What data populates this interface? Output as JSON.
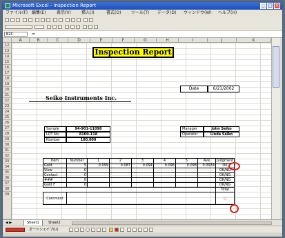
{
  "window": {
    "title": "Microsoft Excel - Inspection Report"
  },
  "menu": [
    "ファイル(F)",
    "編集(E)",
    "表示(V)",
    "挿入(I)",
    "書式(O)",
    "ツール(T)",
    "データ(D)",
    "ウィンドウ(W)",
    "ヘルプ(H)"
  ],
  "formula_bar": {
    "cell_ref": "B2C",
    "content": ""
  },
  "columns": [
    "A",
    "B",
    "C",
    "D",
    "E",
    "F",
    "G",
    "H",
    "I",
    "J",
    "K"
  ],
  "rows": [
    "12",
    "13",
    "14",
    "15",
    "16",
    "17",
    "18",
    "19",
    "20",
    "21",
    "22",
    "23",
    "24",
    "25",
    "26",
    "27",
    "28",
    "29",
    "30",
    "31",
    "32",
    "33",
    "34",
    "35",
    "36",
    "37",
    "38",
    "39"
  ],
  "report": {
    "title": "Inspection Report",
    "date_label": "Date",
    "date_value": "6/21/2002",
    "company": "Seiko Instruments Inc.",
    "sample_label": "Sample",
    "sample_value": "94-901-11098",
    "lot_label": "LOT No.",
    "lot_value": "8100-118",
    "number_label": "Number",
    "number_value": "100,000",
    "manager_label": "Manager",
    "manager_value": "John Seiko",
    "operator_label": "Operator",
    "operator_value": "Linda Seiko"
  },
  "table": {
    "headers": [
      "Item",
      "Number",
      "1",
      "2",
      "3",
      "4",
      "5",
      "Ave",
      "Judgment"
    ],
    "rows": [
      [
        "Gold",
        "5",
        "0.099",
        "0.087",
        "0.094",
        "0.096",
        "0.098",
        "0.0934",
        "OK"
      ],
      [
        "View",
        "0",
        "",
        "",
        "",
        "",
        "",
        "",
        "OK/NG"
      ],
      [
        "Contact",
        "0",
        "",
        "",
        "",
        "",
        "",
        "",
        "OK/NG"
      ],
      [
        "###",
        "0",
        "",
        "",
        "",
        "",
        "",
        "",
        "OK/NG"
      ],
      [
        "Gold F",
        "0",
        "",
        "",
        "",
        "",
        "",
        "",
        "OK/NG"
      ]
    ],
    "total_label": "Total",
    "comment_label": "Comment",
    "total_mark": "○"
  },
  "sheet_tabs": [
    "Sheet1",
    "Sheet2"
  ],
  "drawbar": {
    "label": "オートシェイプ(U)"
  }
}
